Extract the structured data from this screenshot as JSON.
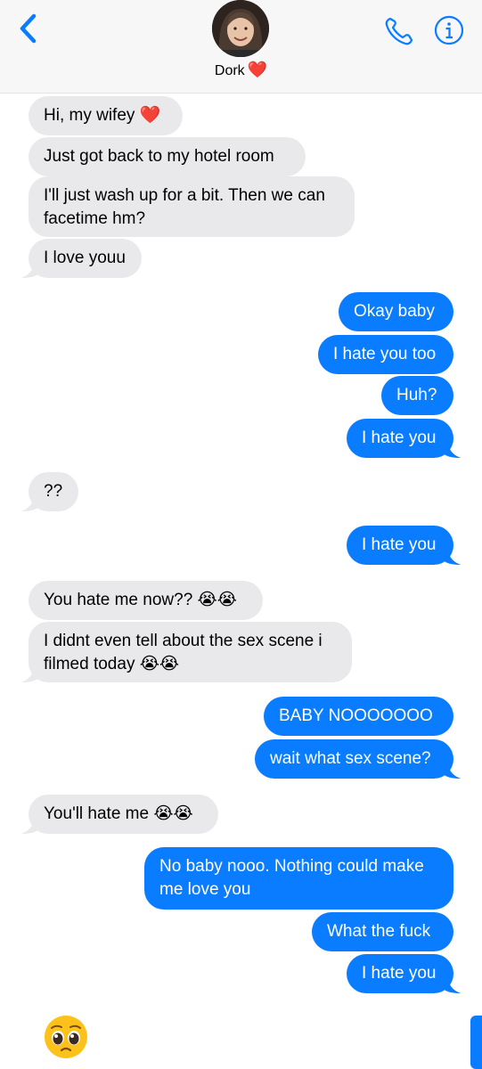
{
  "header": {
    "contact_name": "Dork",
    "heart": "❤️",
    "back_icon": "chevron-left-icon",
    "call_icon": "phone-icon",
    "info_icon": "info-icon"
  },
  "messages": [
    {
      "side": "in",
      "text": "Hi, my wifey ❤️"
    },
    {
      "side": "in",
      "text": "Just got back to my hotel room"
    },
    {
      "side": "in",
      "text": "I'll just wash up for a bit. Then we can facetime hm?"
    },
    {
      "side": "in",
      "text": "I love youu"
    },
    {
      "side": "out",
      "text": "Okay baby"
    },
    {
      "side": "out",
      "text": "I hate you too"
    },
    {
      "side": "out",
      "text": "Huh?"
    },
    {
      "side": "out",
      "text": "I hate you"
    },
    {
      "side": "in",
      "text": "??"
    },
    {
      "side": "out",
      "text": "I hate you"
    },
    {
      "side": "in",
      "text": "You hate me now?? 😭😭"
    },
    {
      "side": "in",
      "text": "I didnt even tell about the sex scene i filmed today 😭😭"
    },
    {
      "side": "out",
      "text": "BABY NOOOOOOO"
    },
    {
      "side": "out",
      "text": "wait what sex scene?"
    },
    {
      "side": "in",
      "text": "You'll hate me 😭😭"
    },
    {
      "side": "out",
      "text": "No baby nooo. Nothing could make me love you"
    },
    {
      "side": "out",
      "text": "What the fuck"
    },
    {
      "side": "out",
      "text": "I hate you"
    }
  ],
  "draft_emoji": "🥺",
  "colors": {
    "outgoing": "#0a7cff",
    "incoming": "#e9e9eb",
    "accent": "#0a7cff"
  }
}
